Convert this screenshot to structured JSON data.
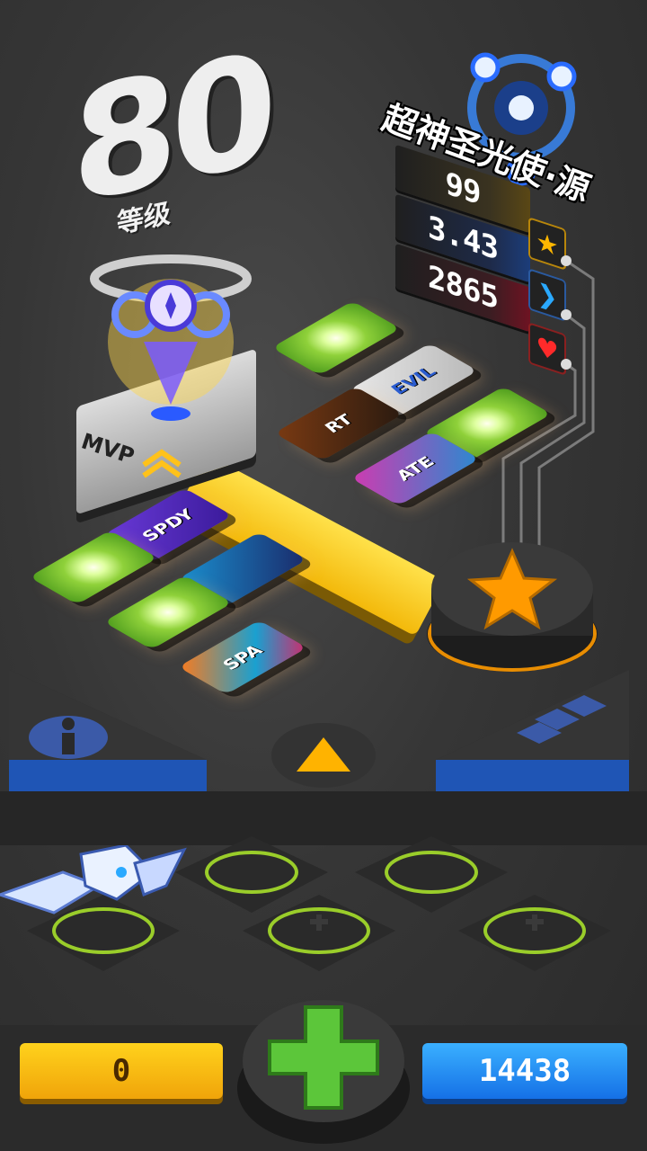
{
  "level": {
    "value": "80",
    "label": "等级"
  },
  "character": {
    "name": "超神圣光使·源",
    "pedestal_label": "MVP"
  },
  "stats": [
    {
      "value": "99",
      "icon": "star-icon",
      "color": "#ffb700"
    },
    {
      "value": "3.43",
      "icon": "chevron-right-icon",
      "color": "#2aa9ff"
    },
    {
      "value": "2865",
      "icon": "heart-icon",
      "color": "#ff2a2a"
    }
  ],
  "tiles": [
    {
      "label": "",
      "kind": "green-gem"
    },
    {
      "label": "EVIL",
      "kind": "badge"
    },
    {
      "label": "RT",
      "kind": "badge"
    },
    {
      "label": "",
      "kind": "green-gem"
    },
    {
      "label": "ATE",
      "kind": "badge"
    },
    {
      "label": "SPDY",
      "kind": "badge"
    },
    {
      "label": "",
      "kind": "green-gem"
    },
    {
      "label": "",
      "kind": "badge"
    },
    {
      "label": "",
      "kind": "green-gem"
    },
    {
      "label": "SPA",
      "kind": "badge"
    }
  ],
  "currency": {
    "gold": "0",
    "gems": "14438"
  },
  "colors": {
    "accent_orange": "#ff9a00",
    "accent_green": "#5cc63a",
    "accent_blue": "#1570e6",
    "accent_yellow": "#ffd21c"
  }
}
